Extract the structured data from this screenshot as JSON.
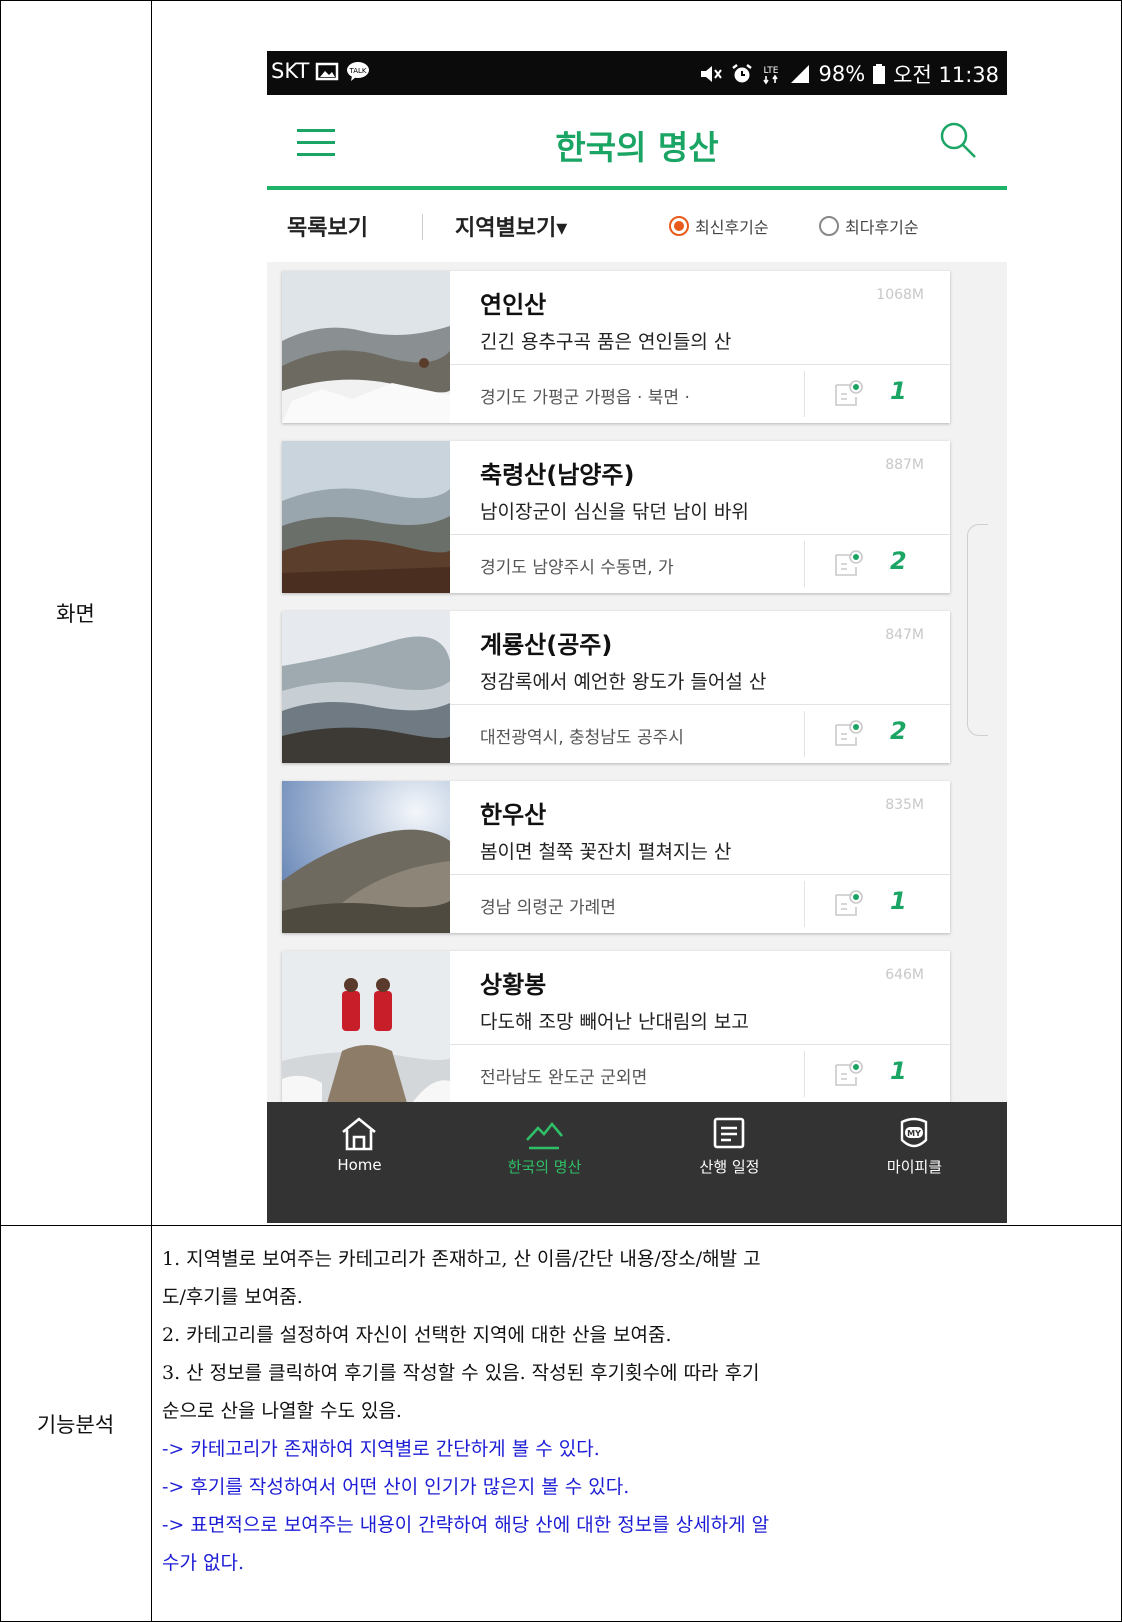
{
  "table": {
    "row1_label": "화면",
    "row2_label": "기능분석"
  },
  "status_bar": {
    "carrier": "SKT",
    "battery": "98%",
    "time": "오전 11:38"
  },
  "app_bar": {
    "title": "한국의 명산"
  },
  "filter_bar": {
    "list_view": "목록보기",
    "region_view": "지역별보기▾",
    "sort_latest": "최신후기순",
    "sort_most": "최다후기순",
    "selected_sort": "최신후기순"
  },
  "mountains": [
    {
      "name": "연인산",
      "altitude": "1068M",
      "desc": "긴긴 용추구곡 품은 연인들의 산",
      "location": "경기도 가평군 가평읍 · 북면 ·",
      "reviews": "1"
    },
    {
      "name": "축령산(남양주)",
      "altitude": "887M",
      "desc": "남이장군이 심신을 닦던 남이 바위",
      "location": "경기도 남양주시 수동면, 가",
      "reviews": "2"
    },
    {
      "name": "계룡산(공주)",
      "altitude": "847M",
      "desc": "정감록에서 예언한 왕도가 들어설 산",
      "location": "대전광역시, 충청남도 공주시",
      "reviews": "2"
    },
    {
      "name": "한우산",
      "altitude": "835M",
      "desc": "봄이면 철쭉 꽃잔치 펼쳐지는 산",
      "location": "경남 의령군 가례면",
      "reviews": "1"
    },
    {
      "name": "상황봉",
      "altitude": "646M",
      "desc": "다도해 조망 빼어난 난대림의 보고",
      "location": "전라남도 완도군 군외면",
      "reviews": "1"
    }
  ],
  "bottom_nav": [
    {
      "label": "Home",
      "icon": "home-icon"
    },
    {
      "label": "한국의 명산",
      "icon": "mountain-icon",
      "active": true
    },
    {
      "label": "산행 일정",
      "icon": "schedule-icon"
    },
    {
      "label": "마이피클",
      "icon": "my-icon"
    }
  ],
  "analysis": {
    "lines": [
      "1. 지역별로 보여주는 카테고리가 존재하고, 산 이름/간단 내용/장소/해발 고",
      "도/후기를 보여줌.",
      "2. 카테고리를 설정하여 자신이 선택한 지역에 대한 산을 보여줌.",
      "3. 산 정보를 클릭하여 후기를 작성할 수 있음. 작성된 후기횟수에 따라 후기",
      "순으로 산을 나열할 수도 있음."
    ],
    "notes": [
      "-> 카테고리가 존재하여 지역별로 간단하게 볼 수 있다.",
      "-> 후기를 작성하여서 어떤 산이 인기가 많은지 볼 수 있다.",
      "-> 표면적으로 보여주는 내용이 간략하여 해당 산에 대한 정보를 상세하게 알",
      "수가 없다."
    ]
  },
  "colors": {
    "accent_green": "#1ba564",
    "radio_orange": "#e85a1a",
    "note_blue": "#1d1dd6",
    "nav_bg": "#333333"
  }
}
